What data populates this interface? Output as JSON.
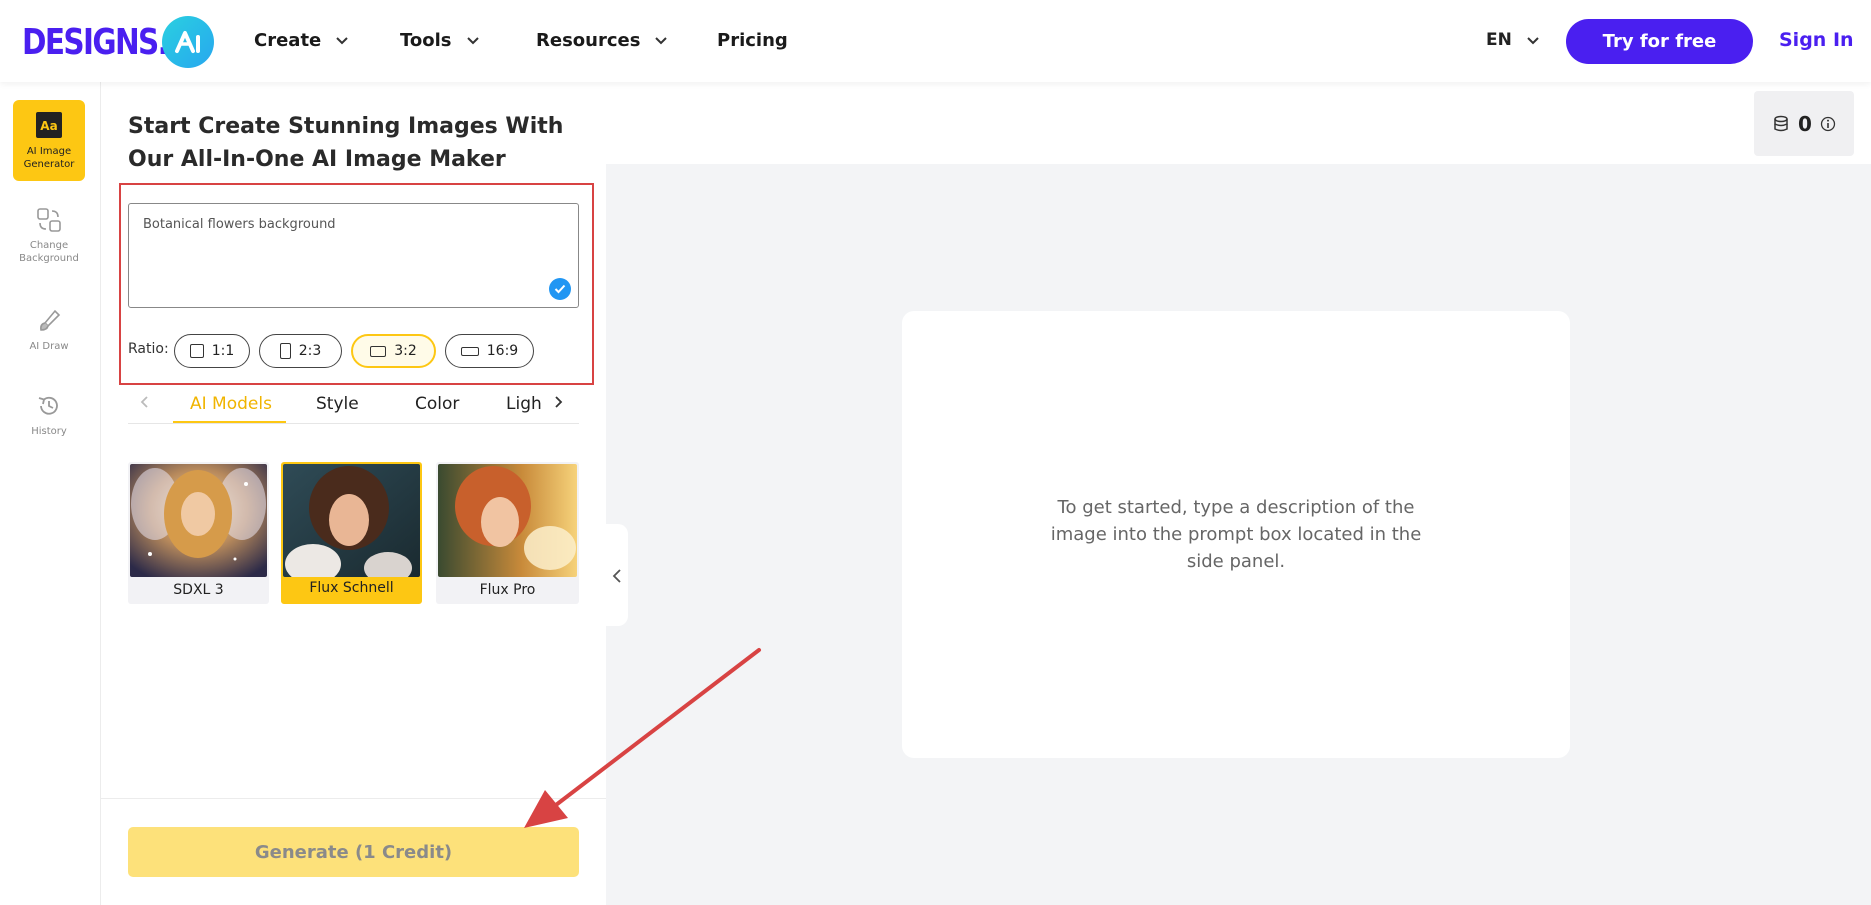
{
  "header": {
    "logo_text": "DESIGNS.",
    "logo_badge": "AI",
    "nav": [
      {
        "label": "Create",
        "icon": "chevron-down-icon"
      },
      {
        "label": "Tools",
        "icon": "chevron-down-icon"
      },
      {
        "label": "Resources",
        "icon": "chevron-down-icon"
      },
      {
        "label": "Pricing"
      }
    ],
    "language": "EN",
    "try_label": "Try for free",
    "signin_label": "Sign In"
  },
  "rail": [
    {
      "label": "AI Image Generator",
      "icon": "text-aa-icon",
      "active": true
    },
    {
      "label": "Change Background",
      "icon": "change-background-icon"
    },
    {
      "label": "AI Draw",
      "icon": "brush-icon"
    },
    {
      "label": "History",
      "icon": "history-icon"
    }
  ],
  "panel": {
    "title": "Start Create Stunning Images With Our All-In-One AI Image Maker",
    "prompt_value": "Botanical flowers background",
    "ratio_label": "Ratio:",
    "ratios": [
      {
        "label": "1:1"
      },
      {
        "label": "2:3"
      },
      {
        "label": "3:2",
        "active": true
      },
      {
        "label": "16:9"
      }
    ],
    "tabs": [
      {
        "label": "AI Models",
        "active": true
      },
      {
        "label": "Style"
      },
      {
        "label": "Color"
      },
      {
        "label": "Lighting"
      }
    ],
    "models": [
      {
        "label": "SDXL 3"
      },
      {
        "label": "Flux Schnell",
        "active": true
      },
      {
        "label": "Flux Pro"
      }
    ],
    "generate_label": "Generate (1 Credit)"
  },
  "main": {
    "credits": "0",
    "empty_message": "To get started, type a description of the image into the prompt box located in the side panel."
  },
  "colors": {
    "brand": "#4a1ff0",
    "accent": "#fdc713",
    "annotation": "#d84343"
  }
}
